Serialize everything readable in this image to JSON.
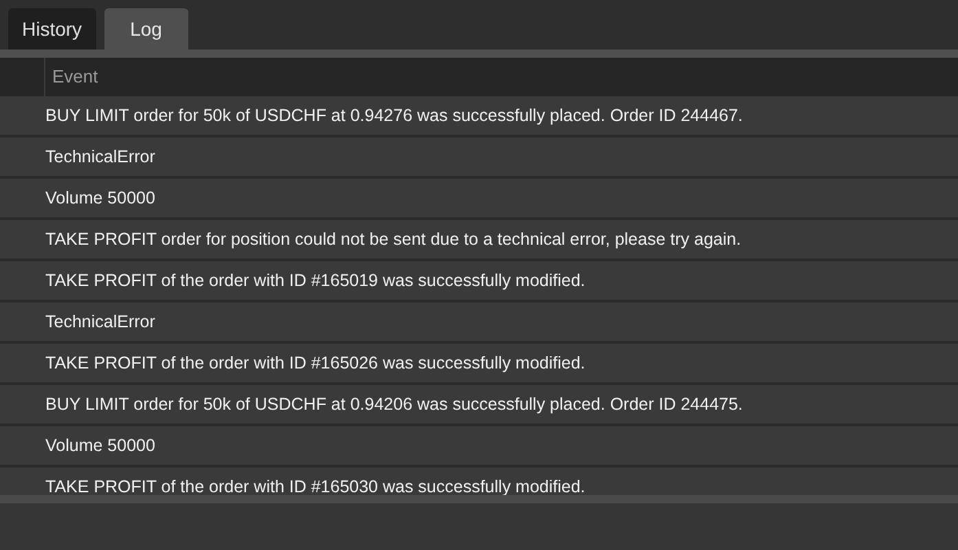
{
  "tabs": [
    {
      "label": "History",
      "selected": false
    },
    {
      "label": "Log",
      "selected": true
    }
  ],
  "table": {
    "columns": [
      "Event"
    ],
    "rows": [
      "BUY LIMIT order for 50k of USDCHF at 0.94276 was successfully placed. Order ID 244467.",
      "TechnicalError",
      "Volume 50000",
      "TAKE PROFIT order for position could not be sent due to a technical error, please try again.",
      "TAKE PROFIT of the order with ID #165019 was successfully modified.",
      "TechnicalError",
      "TAKE PROFIT of the order with ID #165026 was successfully modified.",
      "BUY LIMIT order for 50k of USDCHF at 0.94206 was successfully placed. Order ID 244475.",
      "Volume 50000",
      "TAKE PROFIT of the order with ID #165030 was successfully modified."
    ]
  }
}
